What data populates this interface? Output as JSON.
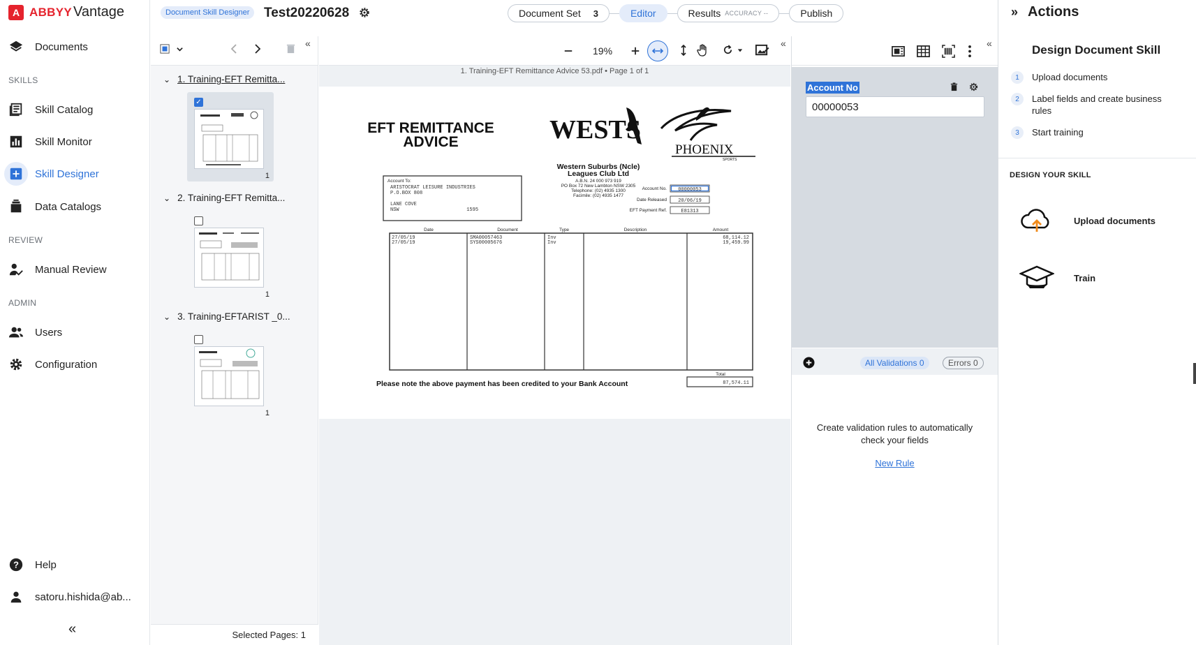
{
  "app": {
    "brand_1": "ABBYY",
    "brand_2": "Vantage"
  },
  "sidebar": {
    "documents": "Documents",
    "section_skills": "SKILLS",
    "skill_catalog": "Skill Catalog",
    "skill_monitor": "Skill Monitor",
    "skill_designer": "Skill Designer",
    "data_catalogs": "Data Catalogs",
    "section_review": "REVIEW",
    "manual_review": "Manual Review",
    "section_admin": "ADMIN",
    "users": "Users",
    "configuration": "Configuration",
    "help": "Help",
    "user": "satoru.hishida@ab...",
    "collapse": "«"
  },
  "header": {
    "tag": "Document Skill Designer",
    "title": "Test20220628",
    "steps": {
      "document_set": "Document Set",
      "document_set_count": "3",
      "editor": "Editor",
      "results": "Results",
      "results_sub": "ACCURACY --",
      "publish": "Publish"
    }
  },
  "pages_panel": {
    "groups": [
      {
        "title": "1. Training-EFT Remitta...",
        "page": "1"
      },
      {
        "title": "2. Training-EFT Remitta...",
        "page": "1"
      },
      {
        "title": "3. Training-EFTARIST _0...",
        "page": "1"
      }
    ],
    "selected_pages": "Selected Pages: 1"
  },
  "viewer": {
    "zoom": "19%",
    "file_name": "1. Training-EFT Remittance Advice 53.pdf • Page 1 of 1",
    "doc": {
      "title": "EFT REMITTANCE\nADVICE",
      "logo1": "WESTS",
      "logo2": "PHOENIX",
      "logo2_sub": "SPORTS",
      "company": "Western Suburbs (Ncle)\nLeagues Club Ltd",
      "company_lines": [
        "A.B.N. 24 000 973 919",
        "PO Box 72 New Lambton NSW 2305",
        "Telephone: (02) 4935 1300",
        "Facimile: (02) 4935 1477"
      ],
      "account_to_label": "Account To:",
      "account_to": [
        "ARISTOCRAT LEISURE INDUSTRIES",
        "P.O.BOX 808",
        "",
        "LANE COVE",
        "NSW                       1595"
      ],
      "meta": [
        {
          "label": "Account No.",
          "value": "00000053"
        },
        {
          "label": "Date Released",
          "value": "20/06/19"
        },
        {
          "label": "EFT Payment Ref.",
          "value": "E81313"
        }
      ],
      "columns": [
        "Date",
        "Document",
        "Type",
        "Description",
        "Amount"
      ],
      "rows": [
        {
          "date": "27/05/19",
          "document": "SMA00057463",
          "type": "Inv",
          "description": "",
          "amount": "68,114.12"
        },
        {
          "date": "27/05/19",
          "document": "SYS00005676",
          "type": "Inv",
          "description": "",
          "amount": "19,459.99"
        }
      ],
      "total_label": "Total",
      "total": "87,574.11",
      "note": "Please note the above payment has been credited to your Bank Account"
    }
  },
  "fields_panel": {
    "field_label": "Account No",
    "field_value": "00000053",
    "all_validations": "All Validations 0",
    "errors": "Errors 0",
    "empty_text": "Create validation rules to automatically check your fields",
    "new_rule": "New Rule"
  },
  "actions_panel": {
    "title": "Actions",
    "subtitle": "Design Document Skill",
    "steps": [
      {
        "n": "1",
        "label": "Upload documents"
      },
      {
        "n": "2",
        "label": "Label fields and create business rules"
      },
      {
        "n": "3",
        "label": "Start training"
      }
    ],
    "section": "DESIGN YOUR SKILL",
    "upload": "Upload documents",
    "train": "Train"
  },
  "colors": {
    "accent": "#2f73d8",
    "brand": "#e5232d"
  }
}
